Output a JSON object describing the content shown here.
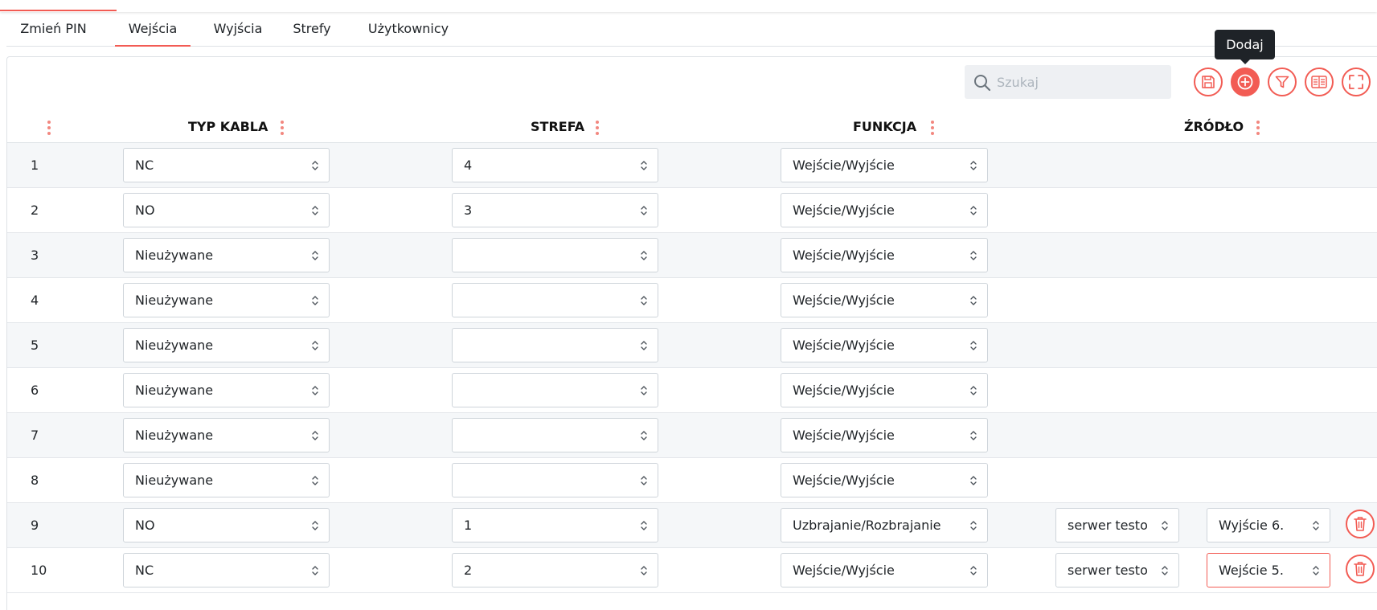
{
  "tabs": [
    {
      "label": "Zmień PIN",
      "active": false
    },
    {
      "label": "Wejścia",
      "active": true
    },
    {
      "label": "Wyjścia",
      "active": false
    },
    {
      "label": "Strefy",
      "active": false
    },
    {
      "label": "Użytkownicy",
      "active": false
    }
  ],
  "toolbar": {
    "search_placeholder": "Szukaj",
    "tooltip": "Dodaj",
    "buttons": [
      "save-icon",
      "add-circle-icon",
      "filter-icon",
      "columns-icon",
      "fullscreen-icon"
    ]
  },
  "columns": {
    "typ_kabla": "TYP KABLA",
    "strefa": "STREFA",
    "funkcja": "FUNKCJA",
    "zrodlo": "ŹRÓDŁO"
  },
  "rows": [
    {
      "num": "1",
      "typ": "NC",
      "strefa": "4",
      "funkcja": "Wejście/Wyjście"
    },
    {
      "num": "2",
      "typ": "NO",
      "strefa": "3",
      "funkcja": "Wejście/Wyjście"
    },
    {
      "num": "3",
      "typ": "Nieużywane",
      "strefa": "",
      "funkcja": "Wejście/Wyjście"
    },
    {
      "num": "4",
      "typ": "Nieużywane",
      "strefa": "",
      "funkcja": "Wejście/Wyjście"
    },
    {
      "num": "5",
      "typ": "Nieużywane",
      "strefa": "",
      "funkcja": "Wejście/Wyjście"
    },
    {
      "num": "6",
      "typ": "Nieużywane",
      "strefa": "",
      "funkcja": "Wejście/Wyjście"
    },
    {
      "num": "7",
      "typ": "Nieużywane",
      "strefa": "",
      "funkcja": "Wejście/Wyjście"
    },
    {
      "num": "8",
      "typ": "Nieużywane",
      "strefa": "",
      "funkcja": "Wejście/Wyjście"
    },
    {
      "num": "9",
      "typ": "NO",
      "strefa": "1",
      "funkcja": "Uzbrajanie/Rozbrajanie",
      "zrodlo_serwer": "serwer testo",
      "zrodlo_wyjscie": "Wyjście 6."
    },
    {
      "num": "10",
      "typ": "NC",
      "strefa": "2",
      "funkcja": "Wejście/Wyjście",
      "zrodlo_serwer": "serwer testo",
      "zrodlo_wyjscie": "Wejście 5."
    }
  ],
  "colors": {
    "accent": "#f25c54",
    "tooltip_bg": "#1f2328",
    "row_alt": "#f5f7f9"
  }
}
